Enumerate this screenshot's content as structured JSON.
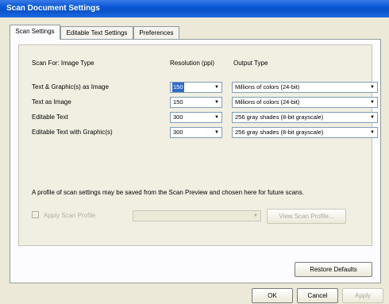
{
  "window": {
    "title": "Scan Document Settings"
  },
  "tabs": [
    {
      "label": "Scan Settings"
    },
    {
      "label": "Editable Text Settings"
    },
    {
      "label": "Preferences"
    }
  ],
  "table": {
    "headers": {
      "scan_for": "Scan For:  Image Type",
      "resolution": "Resolution (ppi)",
      "output": "Output Type"
    },
    "rows": [
      {
        "label": "Text & Graphic(s) as Image",
        "resolution": "150",
        "output": "Millions of colors (24-bit)"
      },
      {
        "label": "Text as Image",
        "resolution": "150",
        "output": "Millions of colors (24-bit)"
      },
      {
        "label": "Editable Text",
        "resolution": "300",
        "output": "256 gray shades (8-bit grayscale)"
      },
      {
        "label": "Editable Text with Graphic(s)",
        "resolution": "300",
        "output": "256 gray shades (8-bit grayscale)"
      }
    ]
  },
  "note": "A profile of scan settings may be saved from the Scan Preview and chosen here for future scans.",
  "profile": {
    "checkbox_label": "Apply Scan Profile",
    "view_button": "View Scan Profile..."
  },
  "buttons": {
    "restore": "Restore Defaults",
    "ok": "OK",
    "cancel": "Cancel",
    "apply": "Apply"
  },
  "icons": {
    "dropdown": "▼"
  }
}
